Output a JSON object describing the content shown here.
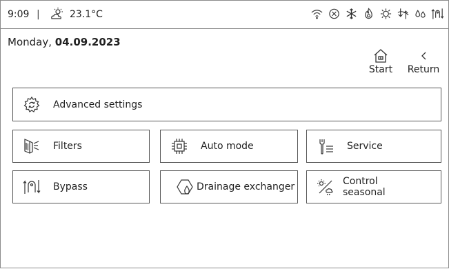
{
  "status_bar": {
    "time": "9:09",
    "separator": "|",
    "temperature": "23.1°C",
    "weather_icon": "sun-cloud-icon",
    "icons": [
      "wifi-icon",
      "error-circle-icon",
      "snowflake-icon",
      "flame-icon",
      "gear-sun-icon",
      "airflow-icon",
      "drops-icon",
      "bypass-icon"
    ]
  },
  "header": {
    "date_prefix": "Monday, ",
    "date_value": "04.09.2023"
  },
  "nav": {
    "start_label": "Start",
    "return_label": "Return",
    "start_icon": "home-icon",
    "return_icon": "chevron-left-icon"
  },
  "menu": {
    "advanced_settings": "Advanced settings",
    "filters": "Filters",
    "auto_mode": "Auto mode",
    "service": "Service",
    "bypass": "Bypass",
    "drainage_exchanger": "Drainage exchanger",
    "control_seasonal": "Control\nseasonal"
  }
}
